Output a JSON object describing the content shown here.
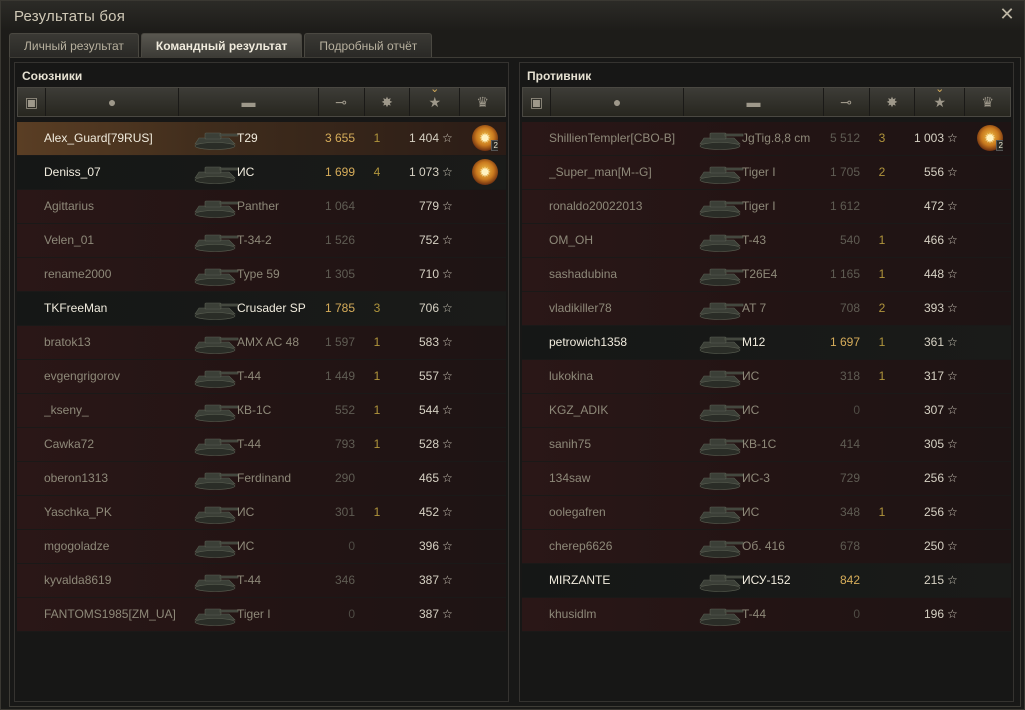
{
  "window": {
    "title": "Результаты боя"
  },
  "tabs": [
    {
      "label": "Личный результат",
      "active": false
    },
    {
      "label": "Командный результат",
      "active": true
    },
    {
      "label": "Подробный отчёт",
      "active": false
    }
  ],
  "colors": {
    "accent": "#d6ad5a",
    "dead_row": "#2a1717",
    "alive_row": "#151716",
    "me_row": "#5a3e24"
  },
  "allies": {
    "title": "Союзники",
    "players": [
      {
        "name": "Alex_Guard[79RUS]",
        "tank": "T29",
        "damage": "3 655",
        "kills": "1",
        "xp": "1 404",
        "status": "me",
        "medal": true,
        "medal_count": "2"
      },
      {
        "name": "Deniss_07",
        "tank": "ИС",
        "damage": "1 699",
        "kills": "4",
        "xp": "1 073",
        "status": "alive",
        "medal": true,
        "medal_count": ""
      },
      {
        "name": "Agittarius",
        "tank": "Panther",
        "damage": "1 064",
        "kills": "",
        "xp": "779",
        "status": "dead",
        "medal": false
      },
      {
        "name": "Velen_01",
        "tank": "T-34-2",
        "damage": "1 526",
        "kills": "",
        "xp": "752",
        "status": "dead",
        "medal": false
      },
      {
        "name": "rename2000",
        "tank": "Type 59",
        "damage": "1 305",
        "kills": "",
        "xp": "710",
        "status": "dead",
        "medal": false
      },
      {
        "name": "TKFreeMan",
        "tank": "Crusader SP",
        "damage": "1 785",
        "kills": "3",
        "xp": "706",
        "status": "alive",
        "medal": false
      },
      {
        "name": "bratok13",
        "tank": "AMX AC 48",
        "damage": "1 597",
        "kills": "1",
        "xp": "583",
        "status": "dead",
        "medal": false
      },
      {
        "name": "evgengrigorov",
        "tank": "T-44",
        "damage": "1 449",
        "kills": "1",
        "xp": "557",
        "status": "dead",
        "medal": false
      },
      {
        "name": "_kseny_",
        "tank": "КВ-1С",
        "damage": "552",
        "kills": "1",
        "xp": "544",
        "status": "dead",
        "medal": false
      },
      {
        "name": "Cawka72",
        "tank": "T-44",
        "damage": "793",
        "kills": "1",
        "xp": "528",
        "status": "dead",
        "medal": false
      },
      {
        "name": "oberon1313",
        "tank": "Ferdinand",
        "damage": "290",
        "kills": "",
        "xp": "465",
        "status": "dead",
        "medal": false
      },
      {
        "name": "Yaschka_PK",
        "tank": "ИС",
        "damage": "301",
        "kills": "1",
        "xp": "452",
        "status": "dead",
        "medal": false
      },
      {
        "name": "mgogoladze",
        "tank": "ИС",
        "damage": "0",
        "kills": "",
        "xp": "396",
        "status": "dead",
        "medal": false
      },
      {
        "name": "kyvalda8619",
        "tank": "T-44",
        "damage": "346",
        "kills": "",
        "xp": "387",
        "status": "dead",
        "medal": false
      },
      {
        "name": "FANTOMS1985[ZM_UA]",
        "tank": "Tiger I",
        "damage": "0",
        "kills": "",
        "xp": "387",
        "status": "dead",
        "medal": false
      }
    ]
  },
  "enemies": {
    "title": "Противник",
    "players": [
      {
        "name": "ShillienTempler[CBO-B]",
        "tank": "JgTig.8,8 cm",
        "damage": "5 512",
        "kills": "3",
        "xp": "1 003",
        "status": "dead",
        "medal": true,
        "medal_count": "2"
      },
      {
        "name": "_Super_man[M--G]",
        "tank": "Tiger I",
        "damage": "1 705",
        "kills": "2",
        "xp": "556",
        "status": "dead",
        "medal": false
      },
      {
        "name": "ronaldo20022013",
        "tank": "Tiger I",
        "damage": "1 612",
        "kills": "",
        "xp": "472",
        "status": "dead",
        "medal": false
      },
      {
        "name": "OM_OH",
        "tank": "T-43",
        "damage": "540",
        "kills": "1",
        "xp": "466",
        "status": "dead",
        "medal": false
      },
      {
        "name": "sashadubina",
        "tank": "T26E4",
        "damage": "1 165",
        "kills": "1",
        "xp": "448",
        "status": "dead",
        "medal": false
      },
      {
        "name": "vladikiller78",
        "tank": "AT 7",
        "damage": "708",
        "kills": "2",
        "xp": "393",
        "status": "dead",
        "medal": false
      },
      {
        "name": "petrowich1358",
        "tank": "M12",
        "damage": "1 697",
        "kills": "1",
        "xp": "361",
        "status": "alive",
        "medal": false
      },
      {
        "name": "lukokina",
        "tank": "ИС",
        "damage": "318",
        "kills": "1",
        "xp": "317",
        "status": "dead",
        "medal": false
      },
      {
        "name": "KGZ_ADIK",
        "tank": "ИС",
        "damage": "0",
        "kills": "",
        "xp": "307",
        "status": "dead",
        "medal": false
      },
      {
        "name": "sanih75",
        "tank": "КВ-1С",
        "damage": "414",
        "kills": "",
        "xp": "305",
        "status": "dead",
        "medal": false
      },
      {
        "name": "134saw",
        "tank": "ИС-3",
        "damage": "729",
        "kills": "",
        "xp": "256",
        "status": "dead",
        "medal": false
      },
      {
        "name": "oolegafren",
        "tank": "ИС",
        "damage": "348",
        "kills": "1",
        "xp": "256",
        "status": "dead",
        "medal": false
      },
      {
        "name": "cherep6626",
        "tank": "Об. 416",
        "damage": "678",
        "kills": "",
        "xp": "250",
        "status": "dead",
        "medal": false
      },
      {
        "name": "MIRZANTE",
        "tank": "ИСУ-152",
        "damage": "842",
        "kills": "",
        "xp": "215",
        "status": "alive",
        "medal": false
      },
      {
        "name": "khusidlm",
        "tank": "T-44",
        "damage": "0",
        "kills": "",
        "xp": "196",
        "status": "dead",
        "medal": false
      }
    ]
  },
  "column_icons": [
    "squad-icon",
    "player-icon",
    "tank-icon",
    "damage-icon",
    "kills-icon",
    "xp-star-icon",
    "medal-icon"
  ]
}
